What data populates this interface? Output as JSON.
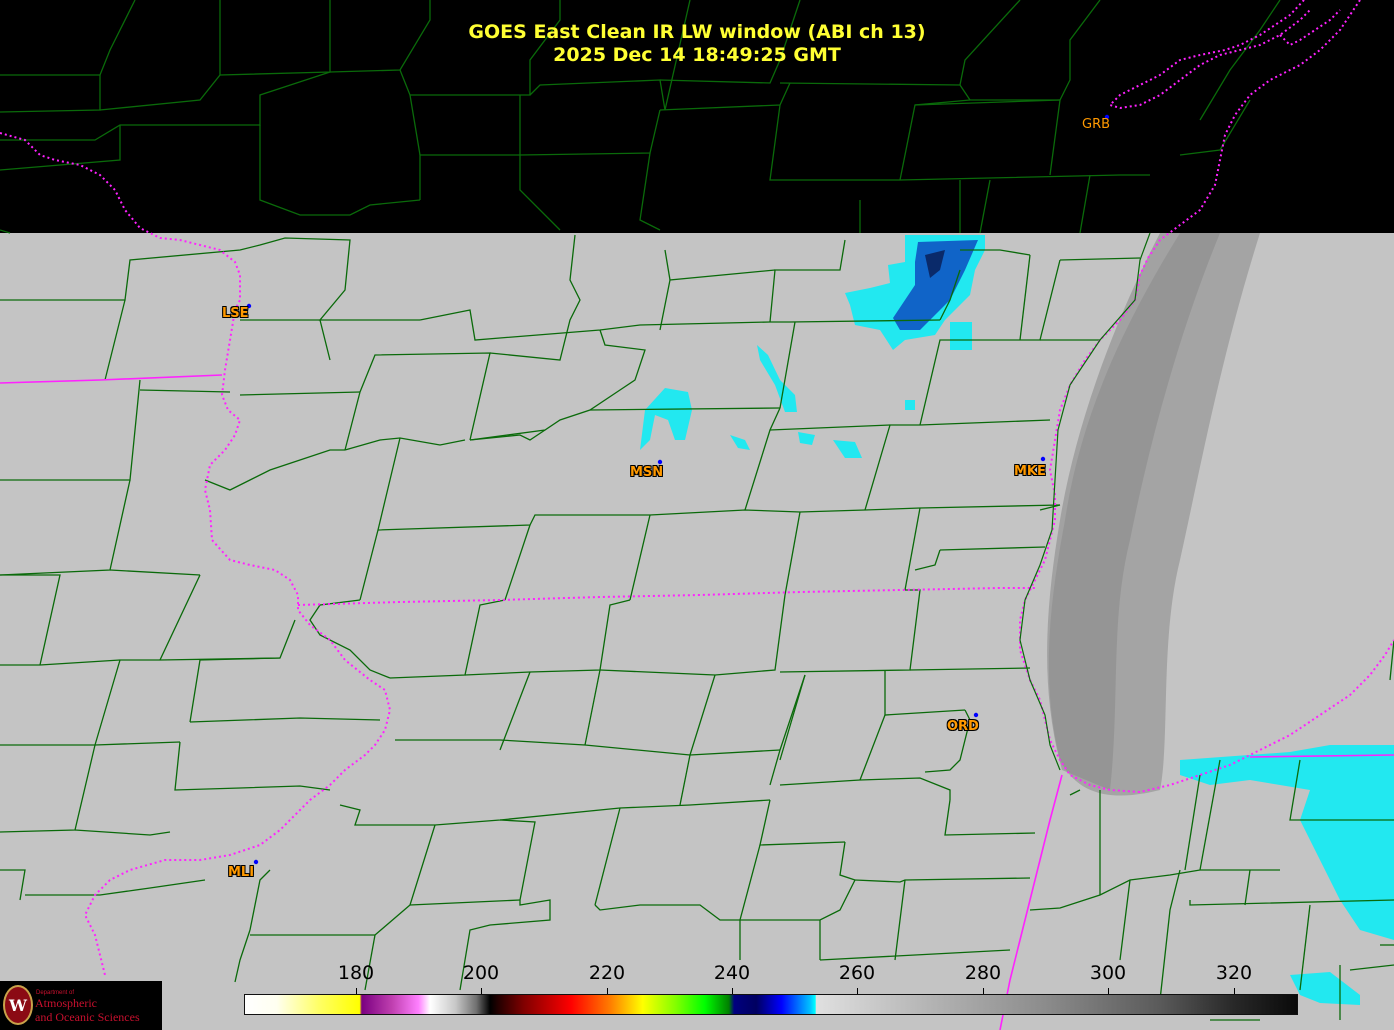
{
  "title": {
    "line1": "GOES East Clean IR LW window (ABI ch 13)",
    "line2": "2025 Dec 14  18:49:25 GMT"
  },
  "cities": [
    {
      "code": "GRB"
    },
    {
      "code": "LSE"
    },
    {
      "code": "MSN"
    },
    {
      "code": "MKE"
    },
    {
      "code": "ORD"
    },
    {
      "code": "MLI"
    }
  ],
  "colorbar": {
    "ticks": [
      "180",
      "200",
      "220",
      "240",
      "260",
      "280",
      "300",
      "320"
    ],
    "range": [
      163,
      330
    ]
  },
  "logo": {
    "line1": "Department of",
    "line2": "Atmospheric",
    "line3": "and Oceanic Sciences",
    "seal": "W"
  },
  "colors": {
    "title": "#ffff33",
    "city_label": "#ff9900",
    "county_lines": "#0a6a0a",
    "state_lines": "#ff22ff",
    "background": "#000000",
    "land_ir": "#c4c4c4"
  }
}
